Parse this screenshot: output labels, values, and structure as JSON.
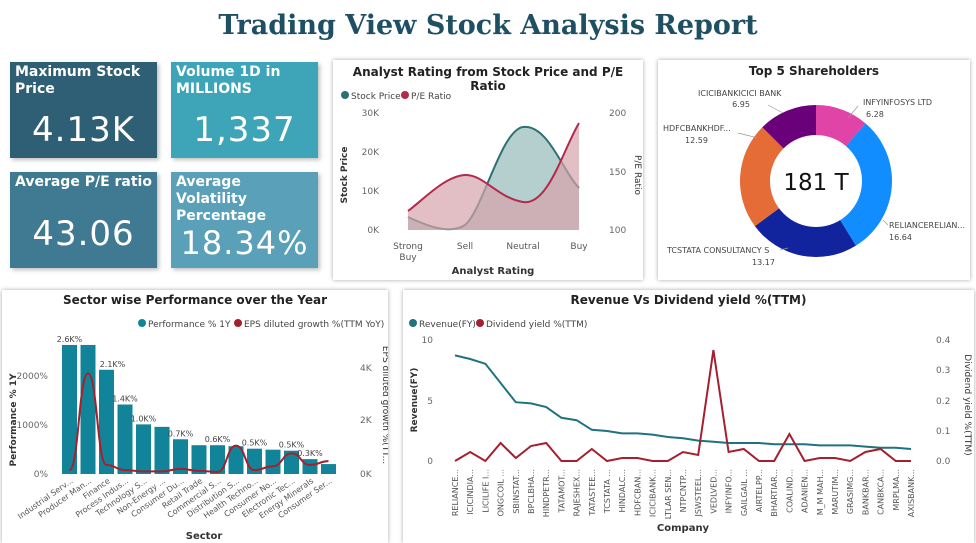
{
  "report_title": "Trading View Stock Analysis Report",
  "kpis": [
    {
      "label": "Maximum Stock Price",
      "value": "4.13K",
      "color": "#2e5f74"
    },
    {
      "label": "Volume 1D in MILLIONS",
      "value": "1,337",
      "color": "#3ea5b8"
    },
    {
      "label": "Average P/E ratio",
      "value": "43.06",
      "color": "#3f7a92"
    },
    {
      "label": "Average Volatility Percentage",
      "value": "18.34%",
      "color": "#5aa0b8"
    }
  ],
  "analyst_chart": {
    "title": "Analyst Rating from Stock Price and P/E Ratio",
    "legend": [
      "Stock Price",
      "P/E Ratio"
    ],
    "xlabel": "Analyst Rating",
    "ylabel_left": "Stock Price",
    "ylabel_right": "P/E Ratio",
    "y_left_ticks": [
      "30K",
      "20K",
      "10K",
      "0K"
    ],
    "y_right_ticks": [
      "200",
      "150",
      "100"
    ],
    "x_ticks": [
      "Strong\nBuy",
      "Sell",
      "Neutral",
      "Buy"
    ]
  },
  "shareholders_chart": {
    "title": "Top 5 Shareholders",
    "center_value": "181 T",
    "slices": [
      {
        "name": "RELIANCERELIAN...",
        "value": "16.64",
        "color": "#118dff"
      },
      {
        "name": "TCSTATA CONSULTANCY S",
        "value": "13.17",
        "color": "#12239e"
      },
      {
        "name": "HDFCBANKHDF...",
        "value": "12.59",
        "color": "#e66c37"
      },
      {
        "name": "ICICIBANKICICI BANK",
        "value": "6.95",
        "color": "#6b007b"
      },
      {
        "name": "INFYINFOSYS LTD",
        "value": "6.28",
        "color": "#e044a7"
      }
    ]
  },
  "sector_chart": {
    "title": "Sector wise Performance over the Year",
    "legend": [
      "Performance % 1Y",
      "EPS diluted growth %(TTM YoY)"
    ],
    "xlabel": "Sector",
    "ylabel_left": "Performance % 1Y",
    "ylabel_right": "EPS diluted growth %(TT...",
    "y_left_ticks": [
      "2000%",
      "1000%",
      "0%"
    ],
    "y_right_ticks": [
      "4K",
      "2K",
      "0K"
    ],
    "data_labels": [
      "2.6K%",
      "2.1K%",
      "1.4K%",
      "1.0K%",
      "0.7K%",
      "0.6K%",
      "0.5K%",
      "0.5K%",
      "0.3K%"
    ]
  },
  "revenue_chart": {
    "title": "Revenue Vs Dividend yield %(TTM)",
    "legend": [
      "Revenue(FY)",
      "Dividend yield %(TTM)"
    ],
    "xlabel": "Company",
    "ylabel_left": "Revenue(FY)",
    "ylabel_right": "Dividend yield %(TTM)",
    "y_left_ticks": [
      "10",
      "5",
      "0"
    ],
    "y_right_ticks": [
      "0.4",
      "0.3",
      "0.2",
      "0.1",
      "0.0"
    ]
  },
  "chart_data": [
    {
      "type": "area",
      "title": "Analyst Rating from Stock Price and P/E Ratio",
      "categories": [
        "Strong Buy",
        "Sell",
        "Neutral",
        "Buy"
      ],
      "series": [
        {
          "name": "Stock Price",
          "values": [
            5000,
            3000,
            27000,
            10000
          ],
          "axis": "left",
          "color": "#2e6f74"
        },
        {
          "name": "P/E Ratio",
          "values": [
            95,
            145,
            80,
            205
          ],
          "axis": "right",
          "color": "#b22b4a"
        }
      ],
      "ylim_left": [
        0,
        30000
      ],
      "ylim_right": [
        100,
        200
      ]
    },
    {
      "type": "pie",
      "title": "Top 5 Shareholders",
      "categories": [
        "RELIANCERELIAN...",
        "TCSTATA CONSULTANCY S",
        "HDFCBANKHDF...",
        "ICICIBANKICICI BANK",
        "INFYINFOSYS LTD"
      ],
      "values": [
        16.64,
        13.17,
        12.59,
        6.95,
        6.28
      ]
    },
    {
      "type": "bar",
      "title": "Sector wise Performance over the Year",
      "categories": [
        "Industrial Serv...",
        "Producer Man...",
        "Finance",
        "Process Indus...",
        "Technology S...",
        "Non-Energy ...",
        "Consumer Du...",
        "Retail Trade",
        "Commercial S...",
        "Distribution S...",
        "Health Techno...",
        "Consumer No...",
        "Electronic Tec...",
        "Energy Minerals",
        "Consumer Ser..."
      ],
      "series": [
        {
          "name": "Performance % 1Y",
          "values": [
            2600,
            2600,
            2100,
            1400,
            1000,
            950,
            700,
            580,
            580,
            560,
            510,
            490,
            470,
            300,
            200
          ],
          "axis": "left",
          "color": "#118499"
        },
        {
          "name": "EPS diluted growth %(TTM YoY)",
          "values": [
            150,
            3900,
            350,
            150,
            100,
            100,
            200,
            120,
            80,
            1100,
            150,
            300,
            800,
            350,
            500
          ],
          "axis": "right",
          "color": "#a4202e"
        }
      ],
      "ylim_left": [
        0,
        2700
      ],
      "ylim_right": [
        0,
        5200
      ]
    },
    {
      "type": "line",
      "title": "Revenue Vs Dividend yield %(TTM)",
      "categories": [
        "RELIANCE...",
        "ICICINDIA...",
        "LICILIFE I...",
        "ONGCOIL ...",
        "SBINSTAT...",
        "BPCLBHA...",
        "HINDPETR...",
        "TATAMOT...",
        "RAJESHEX...",
        "TATASTEE...",
        "TCSTATA ...",
        "HINDALC...",
        "HDFCBAN...",
        "ICICIBANK...",
        "LTLAR SEN...",
        "NTPCNTP...",
        "JSWSTEEL...",
        "VEDLVED...",
        "INFYINFO...",
        "GAILGAIL ...",
        "AIRTELPP...",
        "BHARTIAR...",
        "COALIND...",
        "ADANIEN...",
        "M_M MAH...",
        "MARUTIM...",
        "GRASIMG...",
        "BANKBAR...",
        "CANBKCA...",
        "MRPLMA...",
        "AXISBANK..."
      ],
      "series": [
        {
          "name": "Revenue(FY)",
          "values": [
            8.8,
            8.5,
            8.1,
            6.5,
            4.9,
            4.8,
            4.5,
            3.6,
            3.4,
            2.6,
            2.5,
            2.3,
            2.3,
            2.2,
            2.0,
            1.9,
            1.7,
            1.6,
            1.5,
            1.5,
            1.5,
            1.4,
            1.4,
            1.4,
            1.3,
            1.3,
            1.3,
            1.2,
            1.1,
            1.1,
            1.0
          ],
          "axis": "left",
          "color": "#1f7280"
        },
        {
          "name": "Dividend yield %(TTM)",
          "values": [
            0.0,
            0.03,
            0.0,
            0.06,
            0.01,
            0.05,
            0.06,
            0.0,
            0.0,
            0.04,
            0.0,
            0.01,
            0.01,
            0.0,
            0.0,
            0.03,
            0.02,
            0.37,
            0.03,
            0.04,
            0.0,
            0.0,
            0.09,
            0.0,
            0.01,
            0.01,
            0.0,
            0.03,
            0.04,
            0.0,
            0.0
          ],
          "axis": "right",
          "color": "#a4202e"
        }
      ],
      "ylim_left": [
        0,
        10
      ],
      "ylim_right": [
        0,
        0.4
      ]
    }
  ]
}
